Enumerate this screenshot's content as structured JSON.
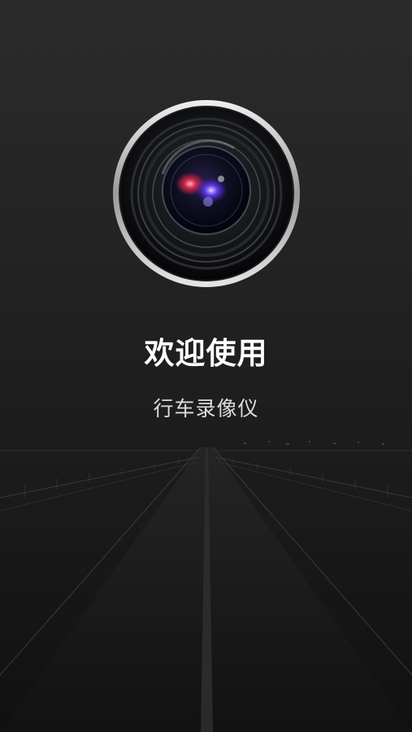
{
  "splash": {
    "title": "欢迎使用",
    "subtitle": "行车录像仪",
    "logo_icon": "camera-lens-icon",
    "background_art": "night-road"
  },
  "colors": {
    "background_top": "#2b2b2b",
    "background_bottom": "#151515",
    "title_text": "#ffffff",
    "subtitle_text": "#dddddd"
  }
}
